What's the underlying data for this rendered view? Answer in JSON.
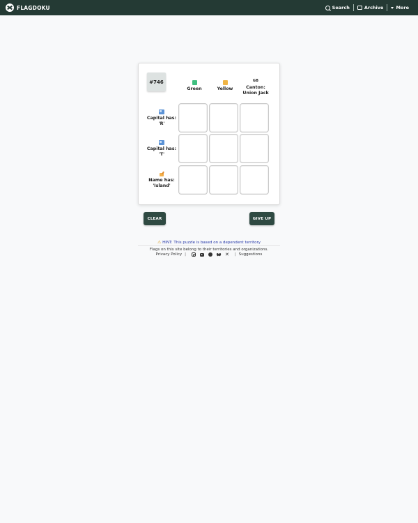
{
  "navbar": {
    "brand": "FLAGDOKU",
    "search_label": "Search",
    "archive_label": "Archive",
    "more_label": "More"
  },
  "puzzle": {
    "number": "#746",
    "columns": [
      {
        "label": "Green",
        "icon": "green-square-icon",
        "color": "#3fbf7f"
      },
      {
        "label": "Yellow",
        "icon": "orange-square-icon",
        "color": "#f0b545"
      },
      {
        "label_top": "Canton:",
        "label_bottom": "Union Jack",
        "icon_text": "GB"
      }
    ],
    "rows": [
      {
        "label_top": "Capital has:",
        "label_bottom": "'R'",
        "icon": "cityscape-icon"
      },
      {
        "label_top": "Capital has:",
        "label_bottom": "'T'",
        "icon": "cityscape-icon"
      },
      {
        "label_top": "Name has:",
        "label_bottom": "'Island'",
        "icon": "writing-hand-icon"
      }
    ],
    "cells": [
      "",
      "",
      "",
      "",
      "",
      "",
      "",
      "",
      ""
    ]
  },
  "buttons": {
    "clear": "CLEAR",
    "give_up": "GIVE UP"
  },
  "hint": {
    "icon": "warning-icon",
    "text": "HINT: This puzzle is based on a dependent territory"
  },
  "footer": {
    "notice": "Flags on this site belong to their territories and organizations.",
    "privacy": "Privacy Policy",
    "suggestions": "Suggestions"
  }
}
